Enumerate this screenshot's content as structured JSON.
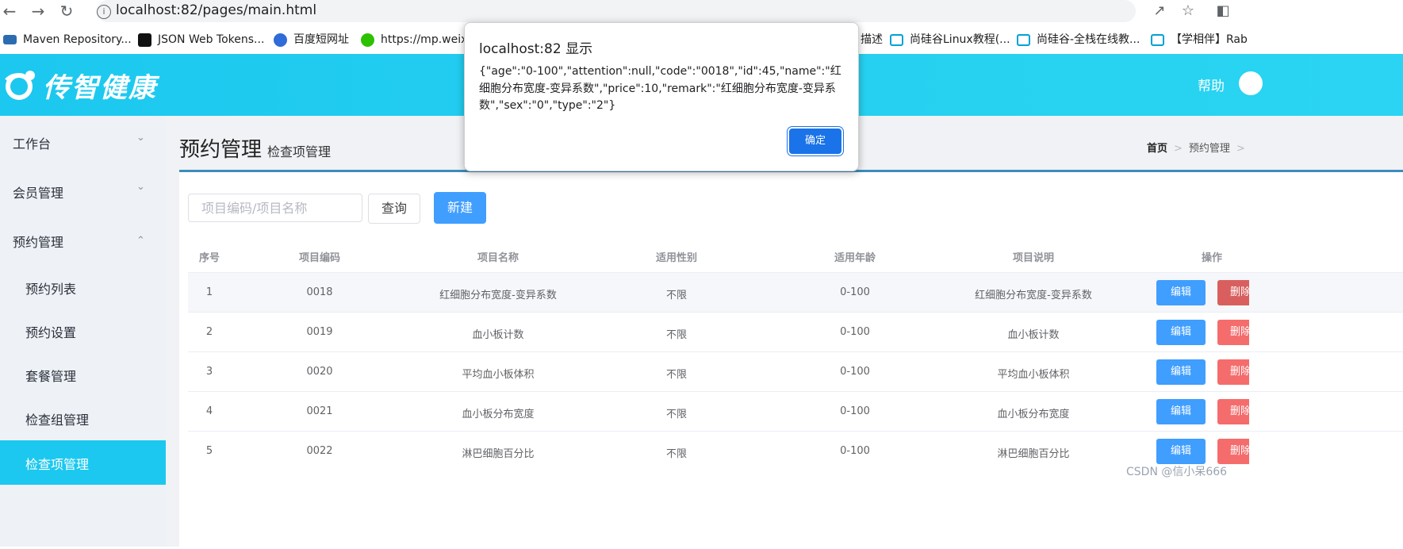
{
  "browser": {
    "url": "localhost:82/pages/main.html",
    "bookmarks": [
      {
        "label": "Maven Repository...",
        "icon": "maven-icon"
      },
      {
        "label": "JSON Web Tokens...",
        "icon": "jwt-icon"
      },
      {
        "label": "百度短网址",
        "icon": "baidu-paw-icon"
      },
      {
        "label": "https://mp.weixi",
        "icon": "wechat-icon"
      },
      {
        "label": "描述",
        "icon": "bilibili-icon"
      },
      {
        "label": "尚硅谷Linux教程(...",
        "icon": "bilibili-icon"
      },
      {
        "label": "尚硅谷-全栈在线教...",
        "icon": "bilibili-icon"
      },
      {
        "label": "【学相伴】Rab",
        "icon": "bilibili-icon"
      }
    ]
  },
  "header": {
    "logo_text": "传智健康",
    "help_label": "帮助"
  },
  "sidebar": {
    "menus": [
      {
        "label": "工作台",
        "expanded": false
      },
      {
        "label": "会员管理",
        "expanded": false
      },
      {
        "label": "预约管理",
        "expanded": true
      }
    ],
    "sub_items": [
      {
        "label": "预约列表"
      },
      {
        "label": "预约设置"
      },
      {
        "label": "套餐管理"
      },
      {
        "label": "检查组管理"
      },
      {
        "label": "检查项管理",
        "active": true
      }
    ]
  },
  "page": {
    "title": "预约管理",
    "subtitle": "检查项管理",
    "breadcrumb": [
      "首页",
      "预约管理"
    ]
  },
  "toolbar": {
    "search_placeholder": "项目编码/项目名称",
    "query_label": "查询",
    "new_label": "新建"
  },
  "table": {
    "columns": [
      "序号",
      "项目编码",
      "项目名称",
      "适用性别",
      "适用年龄",
      "项目说明",
      "操作"
    ],
    "rows": [
      {
        "index": "1",
        "code": "0018",
        "name": "红细胞分布宽度-变异系数",
        "sex": "不限",
        "age": "0-100",
        "remark": "红细胞分布宽度-变异系数"
      },
      {
        "index": "2",
        "code": "0019",
        "name": "血小板计数",
        "sex": "不限",
        "age": "0-100",
        "remark": "血小板计数"
      },
      {
        "index": "3",
        "code": "0020",
        "name": "平均血小板体积",
        "sex": "不限",
        "age": "0-100",
        "remark": "平均血小板体积"
      },
      {
        "index": "4",
        "code": "0021",
        "name": "血小板分布宽度",
        "sex": "不限",
        "age": "0-100",
        "remark": "血小板分布宽度"
      },
      {
        "index": "5",
        "code": "0022",
        "name": "淋巴细胞百分比",
        "sex": "不限",
        "age": "0-100",
        "remark": "淋巴细胞百分比"
      }
    ],
    "edit_label": "编辑",
    "delete_label": "删除"
  },
  "dialog": {
    "title": "localhost:82 显示",
    "message": "{\"age\":\"0-100\",\"attention\":null,\"code\":\"0018\",\"id\":45,\"name\":\"红细胞分布宽度-变异系数\",\"price\":10,\"remark\":\"红细胞分布宽度-变异系数\",\"sex\":\"0\",\"type\":\"2\"}",
    "ok_label": "确定"
  },
  "watermark": "CSDN @信小呆666",
  "colors": {
    "header_bg": "#1cc8ef",
    "primary": "#409eff",
    "danger": "#f56c6c",
    "sidebar_bg": "#eef1f6",
    "panel_border": "#3c8dbc",
    "dialog_ok": "#1a73e8"
  }
}
